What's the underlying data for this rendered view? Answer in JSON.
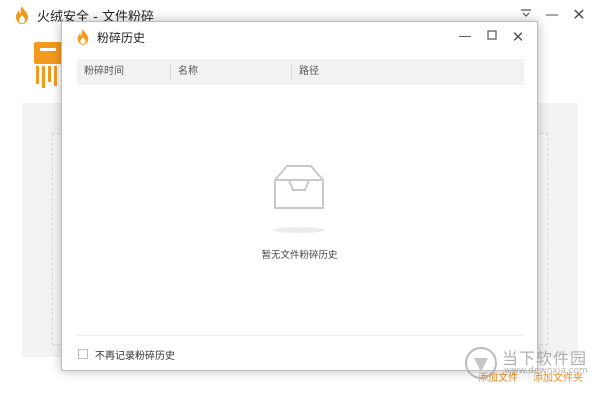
{
  "main_window": {
    "title": "火绒安全 - 文件粉碎",
    "menu_icon": "menu-icon",
    "minimize_icon": "minimize-icon",
    "close_icon": "close-icon",
    "add_file_label": "添加文件",
    "add_folder_label": "添加文件夹",
    "accent_color": "#f08a1c"
  },
  "dialog": {
    "title": "粉碎历史",
    "columns": [
      "粉碎时间",
      "名称",
      "路径"
    ],
    "empty_message": "暂无文件粉碎历史",
    "footer_checkbox_label": "不再记录粉碎历史",
    "footer_checkbox_checked": false,
    "minimize_icon": "minimize-icon",
    "maximize_icon": "maximize-icon",
    "close_icon": "close-icon"
  },
  "watermark": {
    "text": "当下软件园",
    "url": "www.downxia.com"
  }
}
